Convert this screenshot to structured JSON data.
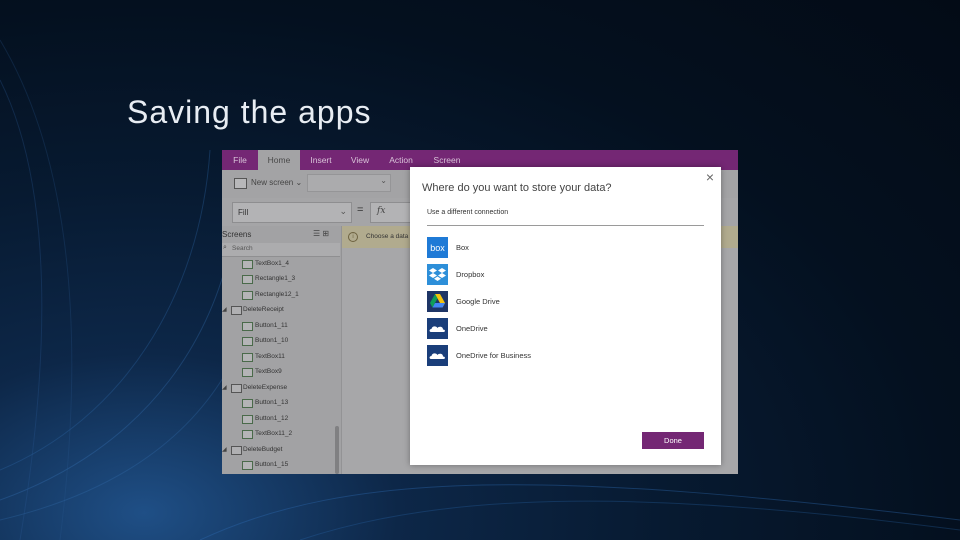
{
  "slide": {
    "title": "Saving the apps"
  },
  "ribbon": {
    "tabs": [
      "File",
      "Home",
      "Insert",
      "View",
      "Action",
      "Screen"
    ],
    "active_tab": "Home",
    "new_screen_label": "New screen"
  },
  "formula_bar": {
    "property": "Fill",
    "equals": "=",
    "fx_label": "fx"
  },
  "screens_panel": {
    "title": "Screens",
    "search_placeholder": "Search",
    "items": [
      {
        "label": "TextBox1_4",
        "kind": "control"
      },
      {
        "label": "Rectangle1_3",
        "kind": "control"
      },
      {
        "label": "Rectangle12_1",
        "kind": "control"
      },
      {
        "label": "DeleteReceipt",
        "kind": "screen"
      },
      {
        "label": "Button1_11",
        "kind": "control"
      },
      {
        "label": "Button1_10",
        "kind": "control"
      },
      {
        "label": "TextBox11",
        "kind": "control"
      },
      {
        "label": "TextBox9",
        "kind": "control"
      },
      {
        "label": "DeleteExpense",
        "kind": "screen"
      },
      {
        "label": "Button1_13",
        "kind": "control"
      },
      {
        "label": "Button1_12",
        "kind": "control"
      },
      {
        "label": "TextBox11_2",
        "kind": "control"
      },
      {
        "label": "DeleteBudget",
        "kind": "screen"
      },
      {
        "label": "Button1_15",
        "kind": "control"
      }
    ]
  },
  "canvas": {
    "banner_text": "Choose a data s"
  },
  "dialog": {
    "title": "Where do you want to store your data?",
    "close_glyph": "×",
    "subtitle": "Use a different connection",
    "services": [
      {
        "label": "Box",
        "icon": "box-icon"
      },
      {
        "label": "Dropbox",
        "icon": "dropbox-icon"
      },
      {
        "label": "Google Drive",
        "icon": "google-drive-icon"
      },
      {
        "label": "OneDrive",
        "icon": "onedrive-icon"
      },
      {
        "label": "OneDrive for Business",
        "icon": "onedrive-business-icon"
      }
    ],
    "done_label": "Done"
  },
  "colors": {
    "accent_purple": "#742774",
    "box_blue": "#1f7ad6",
    "dropbox_blue": "#2d8fd9",
    "onedrive_navy": "#1a3e7a"
  }
}
